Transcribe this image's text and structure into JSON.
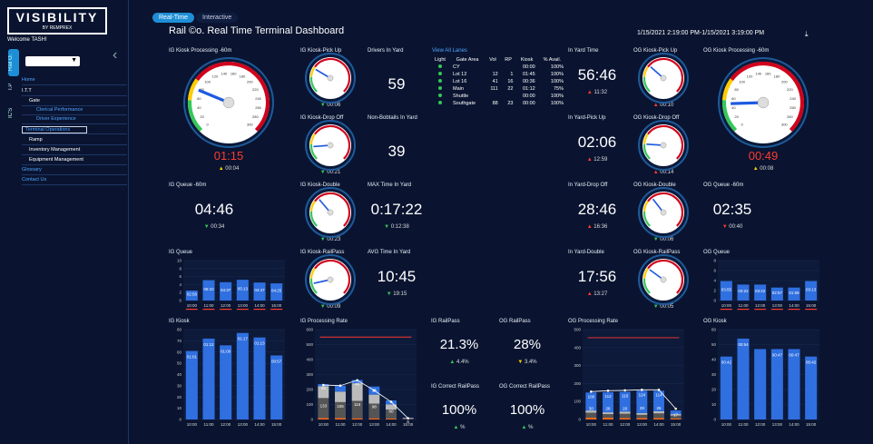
{
  "sidebar": {
    "logo": "VISIBILITY",
    "logo_sub": "BY REMPREX",
    "welcome": "Welcome TASH!",
    "vtabs": [
      "Rail O.",
      "I.P",
      "IC'S"
    ],
    "nav": [
      {
        "label": "Home",
        "blue": true
      },
      {
        "label": "I.T.T",
        "blue": false
      },
      {
        "label": "Gate",
        "blue": false
      },
      {
        "label": "Clerical Performance",
        "blue": true
      },
      {
        "label": "Driver Experience",
        "blue": true
      },
      {
        "label": "Terminal Operations",
        "blue": true,
        "boxed": true
      },
      {
        "label": "Ramp",
        "blue": false
      },
      {
        "label": "Inventory Management",
        "blue": false
      },
      {
        "label": "Equipment Management",
        "blue": false
      },
      {
        "label": "Glossary",
        "blue": true
      },
      {
        "label": "Contact Us",
        "blue": true
      }
    ]
  },
  "tabs": [
    "Real-Time",
    "Interactive"
  ],
  "title": "Rail ©o. Real Time Terminal Dashboard",
  "date_range": "1/15/2021 2:19:00 PM-1/15/2021 3:19:00 PM",
  "download_icon": "download-icon",
  "gauges_large": [
    {
      "label": "IG Kiosk Processing -60m",
      "value": "01:15",
      "delta": "00:04",
      "dir": "up",
      "dcolor": "#ffcc00"
    },
    {
      "label": "OG Kiosk Processing -60m",
      "value": "00:49",
      "delta": "00:08",
      "dir": "up",
      "dcolor": "#ffcc00"
    }
  ],
  "gauge_ticks": [
    "0",
    "20",
    "40",
    "60",
    "80",
    "100",
    "120",
    "140",
    "160",
    "180",
    "200",
    "220",
    "240",
    "260",
    "280",
    "300"
  ],
  "gauges_small": [
    {
      "label": "IG Kiosk-Pick Up",
      "value": "01:01",
      "vcolor": "#ff3b30",
      "delta": "00:06",
      "dir": "down",
      "dcolor": "#35c759"
    },
    {
      "label": "IG Kiosk-Drop Off",
      "value": "00:27",
      "vcolor": "#35c759",
      "delta": "00:21",
      "dir": "down",
      "dcolor": "#35c759"
    },
    {
      "label": "IG Kiosk-Double",
      "value": "00:38",
      "vcolor": "#35c759",
      "delta": "00:23",
      "dir": "down",
      "dcolor": "#35c759"
    },
    {
      "label": "IG Kiosk-RailPass",
      "value": "00:17",
      "vcolor": "#35c759",
      "delta": "00:09",
      "dir": "down",
      "dcolor": "#35c759"
    },
    {
      "label": "OG Kiosk-Pick Up",
      "value": "00:56",
      "vcolor": "#ff3b30",
      "delta": "00:10",
      "dir": "up",
      "dcolor": "#ff3b30"
    },
    {
      "label": "OG Kiosk-Drop Off",
      "value": "00:29",
      "vcolor": "#35c759",
      "delta": "00:14",
      "dir": "up",
      "dcolor": "#ff3b30"
    },
    {
      "label": "OG Kiosk-Double",
      "value": "00:52",
      "vcolor": "#ff3b30",
      "delta": "00:06",
      "dir": "down",
      "dcolor": "#35c759"
    },
    {
      "label": "OG Kiosk-RailPass",
      "value": "00:36",
      "vcolor": "#ff3b30",
      "delta": "00:05",
      "dir": "down",
      "dcolor": "#35c759"
    }
  ],
  "kpis": [
    {
      "label": "Drivers In Yard",
      "value": "59"
    },
    {
      "label": "Non-Bobtails In Yard",
      "value": "39"
    },
    {
      "label": "MAX Time In Yard",
      "value": "0:17:22",
      "delta": "0:12:38",
      "dir": "down",
      "dcolor": "#35c759"
    },
    {
      "label": "AVG Time In Yard",
      "value": "10:45",
      "delta": "19:15",
      "dir": "down",
      "dcolor": "#35c759"
    },
    {
      "label": "IG Queue -60m",
      "value": "04:46",
      "delta": "00:34",
      "dir": "down",
      "dcolor": "#35c759"
    },
    {
      "label": "In Yard Time",
      "value": "56:46",
      "delta": "11:32",
      "dir": "up",
      "dcolor": "#ff3b30"
    },
    {
      "label": "In Yard-Pick Up",
      "value": "02:06",
      "delta": "12:59",
      "dir": "up",
      "dcolor": "#ff3b30"
    },
    {
      "label": "In Yard-Drop Off",
      "value": "28:46",
      "delta": "16:36",
      "dir": "up",
      "dcolor": "#ff3b30"
    },
    {
      "label": "In Yard-Double",
      "value": "17:56",
      "delta": "13:27",
      "dir": "up",
      "dcolor": "#ff3b30"
    },
    {
      "label": "OG Queue -60m",
      "value": "02:35",
      "delta": "00:40",
      "dir": "down",
      "dcolor": "#ff3b30"
    }
  ],
  "railpass": [
    {
      "label": "IG RailPass",
      "value": "21.3%",
      "delta": "4.4%",
      "dir": "up",
      "dcolor": "#35c759"
    },
    {
      "label": "OG RailPass",
      "value": "28%",
      "delta": "3.4%",
      "dir": "down",
      "dcolor": "#ffcc00"
    },
    {
      "label": "IG Correct RailPass",
      "value": "100%",
      "delta": "%",
      "dir": "up",
      "dcolor": "#35c759"
    },
    {
      "label": "OG Correct RailPass",
      "value": "100%",
      "delta": "%",
      "dir": "up",
      "dcolor": "#35c759"
    }
  ],
  "lanes": {
    "link": "View All Lanes",
    "headers": [
      "Light",
      "Gate Area",
      "Vol",
      "RP",
      "Kiosk",
      "% Avail."
    ],
    "rows": [
      [
        "CY",
        "",
        "",
        "00:00",
        "100%"
      ],
      [
        "Lot 12",
        "12",
        "1",
        "01:45",
        "100%"
      ],
      [
        "Lot 16",
        "41",
        "16",
        "00:36",
        "100%"
      ],
      [
        "Main",
        "111",
        "22",
        "01:12",
        "75%"
      ],
      [
        "Shuttle",
        "",
        "",
        "00:00",
        "100%"
      ],
      [
        "Southgate",
        "88",
        "23",
        "00:00",
        "100%"
      ]
    ]
  },
  "chart_data": [
    {
      "id": "ig_queue",
      "type": "bar",
      "title": "IG Queue",
      "categories": [
        "10:00",
        "11:00",
        "12:00",
        "13:00",
        "14:00",
        "15:00"
      ],
      "values": [
        2.5,
        5.1,
        4.6,
        5.2,
        4.5,
        4.3
      ],
      "data_labels": [
        "02:58",
        "05:10",
        "04:37",
        "05:13",
        "04:47",
        "04:25"
      ],
      "ylim": [
        0,
        10
      ],
      "yticks": [
        "0",
        "2",
        "4",
        "6",
        "8",
        "10"
      ],
      "color": "#2f6fe0"
    },
    {
      "id": "og_queue",
      "type": "bar",
      "title": "OG Queue",
      "categories": [
        "10:00",
        "11:00",
        "12:00",
        "13:00",
        "14:00",
        "15:00"
      ],
      "values": [
        3.9,
        3.2,
        3.2,
        2.6,
        2.6,
        3.9
      ],
      "data_labels": [
        "03:55",
        "03:22",
        "03:22",
        "02:57",
        "01:58",
        "03:13"
      ],
      "ylim": [
        0,
        8
      ],
      "yticks": [
        "0",
        "2",
        "4",
        "6",
        "8"
      ],
      "color": "#2f6fe0"
    },
    {
      "id": "ig_kiosk",
      "type": "bar",
      "title": "IG Kiosk",
      "categories": [
        "10:00",
        "11:00",
        "12:00",
        "13:00",
        "14:00",
        "15:00"
      ],
      "values": [
        61,
        72,
        66,
        77,
        73,
        57
      ],
      "data_labels": [
        "01:01",
        "01:12",
        "01:00",
        "01:17",
        "01:13",
        "00:57"
      ],
      "ylim": [
        0,
        80
      ],
      "yticks": [
        "0",
        "10",
        "20",
        "30",
        "40",
        "50",
        "60",
        "70",
        "80"
      ],
      "color": "#2f6fe0"
    },
    {
      "id": "og_kiosk",
      "type": "bar",
      "title": "OG Kiosk",
      "categories": [
        "10:00",
        "11:00",
        "12:00",
        "13:00",
        "14:00",
        "15:00"
      ],
      "values": [
        42,
        54,
        47,
        47,
        47,
        42
      ],
      "data_labels": [
        "00:42",
        "00:54",
        "",
        "00:47",
        "00:47",
        "00:42"
      ],
      "ylim": [
        0,
        60
      ],
      "yticks": [
        "0",
        "10",
        "20",
        "30",
        "40",
        "50",
        "60"
      ],
      "color": "#2f6fe0"
    },
    {
      "id": "ig_rate",
      "type": "bar",
      "stacked": true,
      "title": "IG Processing Rate",
      "categories": [
        "10:00",
        "11:00",
        "12:00",
        "13:00",
        "14:00",
        "15:00"
      ],
      "series": [
        {
          "values": [
            10,
            10,
            8,
            8,
            6,
            2
          ],
          "color": "#ff6b1a"
        },
        {
          "values": [
            133,
            106,
            116,
            98,
            60,
            4
          ],
          "color": "#555555"
        },
        {
          "values": [
            80,
            70,
            118,
            60,
            35,
            4
          ],
          "color": "#bbbbbb"
        },
        {
          "values": [
            13,
            40,
            22,
            54,
            26,
            2
          ],
          "color": "#2f6fe0"
        }
      ],
      "totals": [
        34,
        42,
        46,
        36,
        22,
        5
      ],
      "line_values": [
        230,
        226,
        262,
        194,
        118,
        8
      ],
      "target": 550,
      "ylim": [
        0,
        600
      ],
      "yticks": [
        "0",
        "100",
        "200",
        "300",
        "400",
        "500",
        "600"
      ],
      "labels_top": [
        "34",
        "",
        "46",
        "36",
        "",
        "6"
      ],
      "labels_mid": [
        "133",
        "106",
        "116",
        "98",
        "60",
        ""
      ]
    },
    {
      "id": "og_rate",
      "type": "bar",
      "stacked": true,
      "title": "OG Processing Rate",
      "categories": [
        "10:00",
        "11:00",
        "12:00",
        "13:00",
        "14:00",
        "15:00"
      ],
      "series": [
        {
          "values": [
            10,
            10,
            8,
            8,
            8,
            5
          ],
          "color": "#ff6b1a"
        },
        {
          "values": [
            28,
            20,
            24,
            18,
            26,
            17
          ],
          "color": "#555555"
        },
        {
          "values": [
            12,
            10,
            12,
            10,
            12,
            8
          ],
          "color": "#bbbbbb"
        },
        {
          "values": [
            100,
            112,
            110,
            124,
            114,
            20
          ],
          "color": "#2f6fe0"
        }
      ],
      "line_values": [
        155,
        160,
        162,
        165,
        165,
        60
      ],
      "target": 455,
      "ylim": [
        0,
        500
      ],
      "yticks": [
        "0",
        "100",
        "200",
        "300",
        "400",
        "500"
      ],
      "labels_top": [
        "100",
        "112",
        "110",
        "124",
        "114",
        ""
      ],
      "labels_mid": [
        "30",
        "28",
        "26",
        "28",
        "26",
        "17"
      ]
    }
  ]
}
